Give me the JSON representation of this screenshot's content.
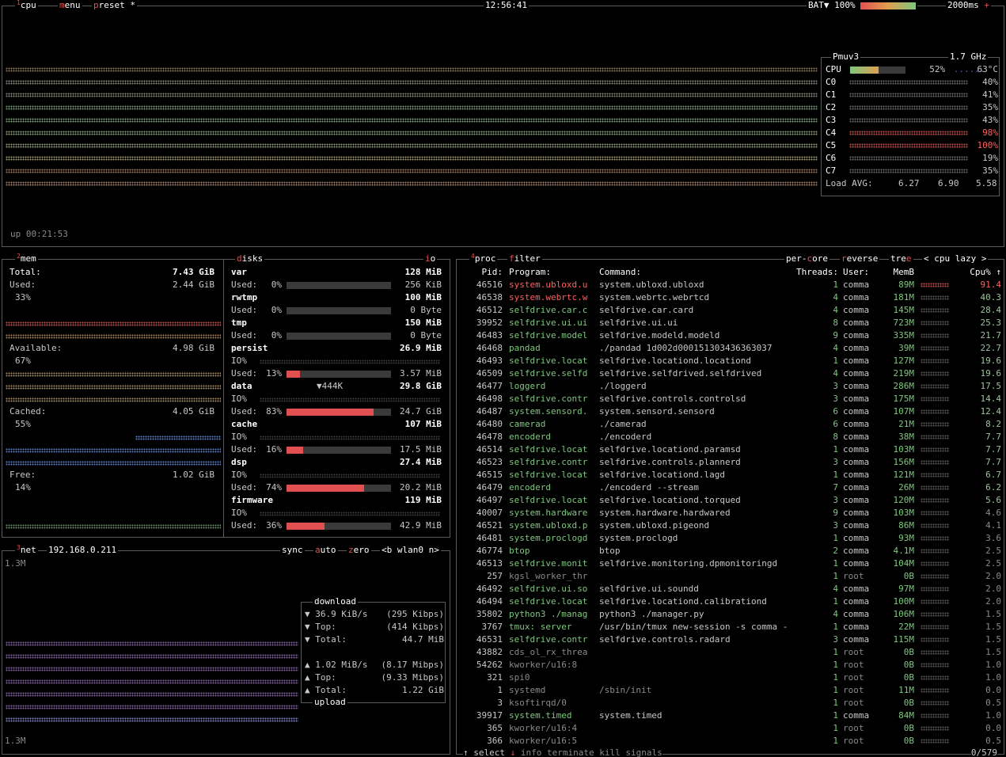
{
  "topbar": {
    "cpu_tab": "cpu",
    "menu_tab": "menu",
    "preset_tab": "preset *",
    "clock": "12:56:41",
    "battery": "BAT▼ 100%",
    "interval": "2000ms"
  },
  "cpu_panel": {
    "uptime": "up 00:21:53",
    "model": "Pmuv3",
    "freq": "1.7 GHz",
    "total": {
      "label": "CPU",
      "pct": "52%",
      "temp": "63°C",
      "fill": 0.52
    },
    "cores": [
      {
        "label": "C0",
        "pct": "40%"
      },
      {
        "label": "C1",
        "pct": "41%"
      },
      {
        "label": "C2",
        "pct": "35%"
      },
      {
        "label": "C3",
        "pct": "43%"
      },
      {
        "label": "C4",
        "pct": "98%"
      },
      {
        "label": "C5",
        "pct": "100%"
      },
      {
        "label": "C6",
        "pct": "19%"
      },
      {
        "label": "C7",
        "pct": "35%"
      }
    ],
    "load_label": "Load AVG:",
    "load": [
      "6.27",
      "6.90",
      "5.58"
    ]
  },
  "mem": {
    "title": "mem",
    "total_label": "Total:",
    "total": "7.43 GiB",
    "used_label": "Used:",
    "used": "2.44 GiB",
    "used_pct": "33%",
    "avail_label": "Available:",
    "avail": "4.98 GiB",
    "avail_pct": "67%",
    "cached_label": "Cached:",
    "cached": "4.05 GiB",
    "cached_pct": "55%",
    "free_label": "Free:",
    "free": "1.02 GiB",
    "free_pct": "14%"
  },
  "disks": {
    "title": "disks",
    "io": "io",
    "items": [
      {
        "name": "var",
        "size": "128 MiB",
        "io": "",
        "used_pct": "0%",
        "used_fill": 0.0,
        "used": "256 KiB"
      },
      {
        "name": "rwtmp",
        "size": "100 MiB",
        "io": "",
        "used_pct": "0%",
        "used_fill": 0.0,
        "used": "0 Byte"
      },
      {
        "name": "tmp",
        "size": "150 MiB",
        "io": "",
        "used_pct": "0%",
        "used_fill": 0.0,
        "used": "0 Byte"
      },
      {
        "name": "persist",
        "size": "26.9 MiB",
        "io": "IO%",
        "used_pct": "13%",
        "used_fill": 0.13,
        "used": "3.57 MiB"
      },
      {
        "name": "data",
        "size": "29.8 GiB",
        "io": "IO%",
        "rate": "▼444K",
        "used_pct": "83%",
        "used_fill": 0.83,
        "used": "24.7 GiB"
      },
      {
        "name": "cache",
        "size": "107 MiB",
        "io": "IO%",
        "used_pct": "16%",
        "used_fill": 0.16,
        "used": "17.5 MiB"
      },
      {
        "name": "dsp",
        "size": "27.4 MiB",
        "io": "IO%",
        "used_pct": "74%",
        "used_fill": 0.74,
        "used": "20.2 MiB"
      },
      {
        "name": "firmware",
        "size": "119 MiB",
        "io": "IO%",
        "used_pct": "36%",
        "used_fill": 0.36,
        "used": "42.9 MiB"
      }
    ],
    "used_label": "Used:"
  },
  "net": {
    "title": "net",
    "ip": "192.168.0.211",
    "sync": "sync",
    "auto": "auto",
    "zero": "zero",
    "iface": "<b wlan0 n>",
    "scale_top": "1.3M",
    "scale_bottom": "1.3M",
    "download_title": "download",
    "upload_title": "upload",
    "dl_rate": "36.9 KiB/s",
    "dl_kbps": "(295 Kibps)",
    "dl_top_label": "Top:",
    "dl_top": "(414 Kibps)",
    "dl_total_label": "Total:",
    "dl_total": "44.7 MiB",
    "ul_rate": "1.02 MiB/s",
    "ul_kbps": "(8.17 Mibps)",
    "ul_top_label": "Top:",
    "ul_top": "(9.33 Mibps)",
    "ul_total_label": "Total:",
    "ul_total": "1.22 GiB"
  },
  "proc": {
    "title": "proc",
    "filter": "filter",
    "per_core": "per-core",
    "reverse": "reverse",
    "tree": "tree",
    "sort": "< cpu lazy >",
    "headers": {
      "pid": "Pid:",
      "program": "Program:",
      "command": "Command:",
      "threads": "Threads:",
      "user": "User:",
      "mem": "MemB",
      "cpu": "Cpu%"
    },
    "rows": [
      [
        "46516",
        "system.ubloxd.u",
        "system.ubloxd.ubloxd",
        "1",
        "comma",
        "89M",
        "91.4"
      ],
      [
        "46538",
        "system.webrtc.w",
        "system.webrtc.webrtcd",
        "4",
        "comma",
        "181M",
        "40.3"
      ],
      [
        "46512",
        "selfdrive.car.c",
        "selfdrive.car.card",
        "4",
        "comma",
        "145M",
        "28.4"
      ],
      [
        "39952",
        "selfdrive.ui.ui",
        "selfdrive.ui.ui",
        "8",
        "comma",
        "723M",
        "25.3"
      ],
      [
        "46483",
        "selfdrive.model",
        "selfdrive.modeld.modeld",
        "9",
        "comma",
        "335M",
        "21.7"
      ],
      [
        "46468",
        "pandad",
        "./pandad 1d002d000151303436363037",
        "4",
        "comma",
        "39M",
        "22.7"
      ],
      [
        "46493",
        "selfdrive.locat",
        "selfdrive.locationd.locationd",
        "1",
        "comma",
        "127M",
        "19.6"
      ],
      [
        "46509",
        "selfdrive.selfd",
        "selfdrive.selfdrived.selfdrived",
        "4",
        "comma",
        "219M",
        "19.6"
      ],
      [
        "46477",
        "loggerd",
        "./loggerd",
        "3",
        "comma",
        "286M",
        "17.5"
      ],
      [
        "46498",
        "selfdrive.contr",
        "selfdrive.controls.controlsd",
        "3",
        "comma",
        "175M",
        "14.4"
      ],
      [
        "46487",
        "system.sensord.",
        "system.sensord.sensord",
        "6",
        "comma",
        "107M",
        "12.4"
      ],
      [
        "46480",
        "camerad",
        "./camerad",
        "6",
        "comma",
        "21M",
        "8.2"
      ],
      [
        "46478",
        "encoderd",
        "./encoderd",
        "8",
        "comma",
        "38M",
        "7.7"
      ],
      [
        "46514",
        "selfdrive.locat",
        "selfdrive.locationd.paramsd",
        "1",
        "comma",
        "103M",
        "7.7"
      ],
      [
        "46523",
        "selfdrive.contr",
        "selfdrive.controls.plannerd",
        "3",
        "comma",
        "156M",
        "7.7"
      ],
      [
        "46515",
        "selfdrive.locat",
        "selfdrive.locationd.lagd",
        "1",
        "comma",
        "121M",
        "6.7"
      ],
      [
        "46479",
        "encoderd",
        "./encoderd --stream",
        "7",
        "comma",
        "26M",
        "6.2"
      ],
      [
        "46497",
        "selfdrive.locat",
        "selfdrive.locationd.torqued",
        "3",
        "comma",
        "120M",
        "5.6"
      ],
      [
        "40007",
        "system.hardware",
        "system.hardware.hardwared",
        "9",
        "comma",
        "103M",
        "4.6"
      ],
      [
        "46521",
        "system.ubloxd.p",
        "system.ubloxd.pigeond",
        "3",
        "comma",
        "86M",
        "4.1"
      ],
      [
        "46481",
        "system.proclogd",
        "system.proclogd",
        "1",
        "comma",
        "93M",
        "3.6"
      ],
      [
        "46774",
        "btop",
        "btop",
        "2",
        "comma",
        "4.1M",
        "2.5"
      ],
      [
        "46513",
        "selfdrive.monit",
        "selfdrive.monitoring.dpmonitoringd",
        "1",
        "comma",
        "104M",
        "2.5"
      ],
      [
        "257",
        "kgsl_worker_thr",
        "",
        "1",
        "root",
        "0B",
        "2.0"
      ],
      [
        "46492",
        "selfdrive.ui.so",
        "selfdrive.ui.soundd",
        "4",
        "comma",
        "97M",
        "2.0"
      ],
      [
        "46494",
        "selfdrive.locat",
        "selfdrive.locationd.calibrationd",
        "1",
        "comma",
        "100M",
        "2.0"
      ],
      [
        "35802",
        "python3 ./manag",
        "python3 ./manager.py",
        "4",
        "comma",
        "106M",
        "1.5"
      ],
      [
        "3767",
        "tmux: server",
        "/usr/bin/tmux new-session -s comma -d",
        "1",
        "comma",
        "22M",
        "1.5"
      ],
      [
        "46531",
        "selfdrive.contr",
        "selfdrive.controls.radard",
        "3",
        "comma",
        "115M",
        "1.5"
      ],
      [
        "43882",
        "cds_ol_rx_threa",
        "",
        "1",
        "root",
        "0B",
        "1.5"
      ],
      [
        "54262",
        "kworker/u16:8",
        "",
        "1",
        "root",
        "0B",
        "1.0"
      ],
      [
        "321",
        "spi0",
        "",
        "1",
        "root",
        "0B",
        "1.0"
      ],
      [
        "1",
        "systemd",
        "/sbin/init",
        "1",
        "root",
        "11M",
        "0.0"
      ],
      [
        "3",
        "ksoftirqd/0",
        "",
        "1",
        "root",
        "0B",
        "0.5"
      ],
      [
        "39917",
        "system.timed",
        "system.timed",
        "1",
        "comma",
        "84M",
        "1.0"
      ],
      [
        "365",
        "kworker/u16:4",
        "",
        "1",
        "root",
        "0B",
        "0.0"
      ],
      [
        "366",
        "kworker/u16:5",
        "",
        "1",
        "root",
        "0B",
        "0.5"
      ]
    ],
    "footer": {
      "select": "select",
      "info": "info",
      "terminate": "terminate",
      "kill": "kill",
      "signals": "signals",
      "count": "0/579"
    }
  },
  "colors": {
    "accent": "#e05050",
    "border": "#5a5a5a",
    "program": "#7ec87e",
    "user": "#c8c8c8"
  }
}
